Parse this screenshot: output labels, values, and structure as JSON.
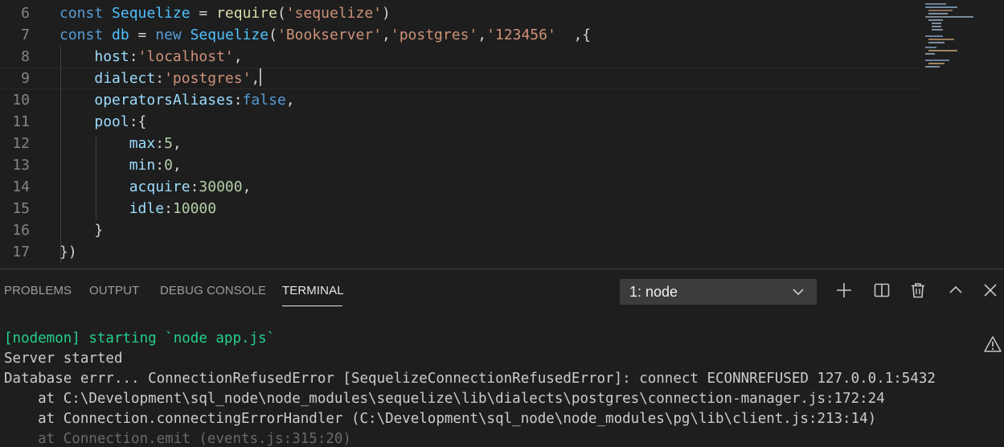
{
  "editor": {
    "lines": [
      {
        "num": "6",
        "tokens": [
          [
            "const ",
            "k"
          ],
          [
            "Sequelize",
            "c"
          ],
          [
            " = ",
            "p"
          ],
          [
            "require",
            "f"
          ],
          [
            "(",
            "p"
          ],
          [
            "'sequelize'",
            "s"
          ],
          [
            ")",
            "p"
          ]
        ]
      },
      {
        "num": "7",
        "tokens": [
          [
            "const ",
            "k"
          ],
          [
            "db",
            "c"
          ],
          [
            " = ",
            "p"
          ],
          [
            "new ",
            "k"
          ],
          [
            "Sequelize",
            "c"
          ],
          [
            "(",
            "p"
          ],
          [
            "'Bookserver'",
            "s"
          ],
          [
            ",",
            "p"
          ],
          [
            "'postgres'",
            "s"
          ],
          [
            ",",
            "p"
          ],
          [
            "'123456'",
            "s"
          ],
          [
            "  ,{",
            "p"
          ]
        ]
      },
      {
        "num": "8",
        "tokens": [
          [
            "    ",
            "p"
          ],
          [
            "host",
            "v"
          ],
          [
            ":",
            "p"
          ],
          [
            "'localhost'",
            "s"
          ],
          [
            ",",
            "p"
          ]
        ]
      },
      {
        "num": "9",
        "tokens": [
          [
            "    ",
            "p"
          ],
          [
            "dialect",
            "v"
          ],
          [
            ":",
            "p"
          ],
          [
            "'postgres'",
            "s"
          ],
          [
            ",",
            "p"
          ]
        ]
      },
      {
        "num": "10",
        "tokens": [
          [
            "    ",
            "p"
          ],
          [
            "operatorsAliases",
            "v"
          ],
          [
            ":",
            "p"
          ],
          [
            "false",
            "k"
          ],
          [
            ",",
            "p"
          ]
        ]
      },
      {
        "num": "11",
        "tokens": [
          [
            "    ",
            "p"
          ],
          [
            "pool",
            "v"
          ],
          [
            ":{",
            "p"
          ]
        ]
      },
      {
        "num": "12",
        "tokens": [
          [
            "        ",
            "p"
          ],
          [
            "max",
            "v"
          ],
          [
            ":",
            "p"
          ],
          [
            "5",
            "n"
          ],
          [
            ",",
            "p"
          ]
        ]
      },
      {
        "num": "13",
        "tokens": [
          [
            "        ",
            "p"
          ],
          [
            "min",
            "v"
          ],
          [
            ":",
            "p"
          ],
          [
            "0",
            "n"
          ],
          [
            ",",
            "p"
          ]
        ]
      },
      {
        "num": "14",
        "tokens": [
          [
            "        ",
            "p"
          ],
          [
            "acquire",
            "v"
          ],
          [
            ":",
            "p"
          ],
          [
            "30000",
            "n"
          ],
          [
            ",",
            "p"
          ]
        ]
      },
      {
        "num": "15",
        "tokens": [
          [
            "        ",
            "p"
          ],
          [
            "idle",
            "v"
          ],
          [
            ":",
            "p"
          ],
          [
            "10000",
            "n"
          ]
        ]
      },
      {
        "num": "16",
        "tokens": [
          [
            "    ",
            "p"
          ],
          [
            "}",
            "p"
          ]
        ]
      },
      {
        "num": "17",
        "tokens": [
          [
            "})",
            "p"
          ]
        ]
      }
    ],
    "current_line_index": 3
  },
  "panel": {
    "tabs": [
      {
        "label": "PROBLEMS",
        "active": false
      },
      {
        "label": "OUTPUT",
        "active": false
      },
      {
        "label": "DEBUG CONSOLE",
        "active": false
      },
      {
        "label": "TERMINAL",
        "active": true
      }
    ],
    "terminal_select": "1: node",
    "actions": {
      "new_terminal_icon": "plus-icon",
      "split_icon": "split-icon",
      "kill_icon": "trash-icon",
      "maximize_icon": "chevron-up-icon",
      "close_icon": "close-icon"
    }
  },
  "terminal": {
    "lines": [
      {
        "text": "[nodemon] starting `node app.js`",
        "style": "green"
      },
      {
        "text": "Server started",
        "style": "normal"
      },
      {
        "text": "Database errr... ConnectionRefusedError [SequelizeConnectionRefusedError]: connect ECONNREFUSED 127.0.0.1:5432",
        "style": "normal"
      },
      {
        "text": "    at C:\\Development\\sql_node\\node_modules\\sequelize\\lib\\dialects\\postgres\\connection-manager.js:172:24",
        "style": "normal"
      },
      {
        "text": "    at Connection.connectingErrorHandler (C:\\Development\\sql_node\\node_modules\\pg\\lib\\client.js:213:14)",
        "style": "normal"
      },
      {
        "text": "    at Connection.emit (events.js:315:20)",
        "style": "dim"
      }
    ],
    "warning_icon": "warning-icon"
  },
  "colors": {
    "background": "#1e1e1e",
    "keyword": "#569cd6",
    "string": "#ce9178",
    "number": "#b5cea8",
    "function": "#dcdcaa",
    "property": "#9cdcfe",
    "constant": "#4fc1ff",
    "terminal_green": "#23d18b"
  }
}
